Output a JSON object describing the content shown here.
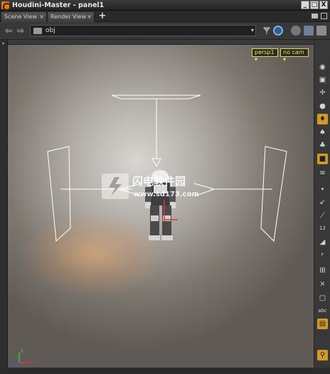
{
  "window": {
    "title": "Houdini-Master - panel1",
    "min_label": "_",
    "max_label": "□",
    "close_label": "X"
  },
  "tabs": [
    {
      "label": "Scene View",
      "close": "×"
    },
    {
      "label": "Render View",
      "close": "×"
    }
  ],
  "tab_add": "+",
  "nav": {
    "back": "⇦",
    "forward": "⇨",
    "path": "obj",
    "dropdown": "▾"
  },
  "viewport": {
    "camera_view": "persp1 ▾",
    "camera": "no cam ▾"
  },
  "watermark": {
    "text": "闪电软件园",
    "url": "www.sd173.com"
  },
  "axes": {
    "x": "x",
    "y": "y",
    "z": "z"
  },
  "toolbar_icons": [
    "eye-icon",
    "lock-icon",
    "link-icon",
    "sphere-icon",
    "bulb-icon",
    "bulb-grid-icon",
    "bulb-person-icon",
    "camera-box-icon",
    "lines-icon",
    "dot-icon",
    "arrow-icon",
    "pin-icon",
    "numbers-icon",
    "brush-icon",
    "corner-icon",
    "grid-icon",
    "cross-icon",
    "frame-icon",
    "abc-icon",
    "display-icon",
    "light-pin-icon"
  ],
  "toolbar_text": {
    "numbers": "12",
    "abc": "abc"
  },
  "colors": {
    "accent": "#d39a2a",
    "dropdown_yellow": "#e8e84a",
    "wireframe": "#ffffff"
  }
}
